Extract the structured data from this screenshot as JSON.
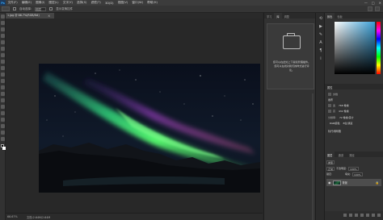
{
  "app": {
    "logo": "Ps",
    "menu": [
      "文件(F)",
      "编辑(E)",
      "图像(I)",
      "图层(L)",
      "文字(Y)",
      "选择(S)",
      "滤镜(T)",
      "3D(D)",
      "视图(V)",
      "窗口(W)",
      "帮助(H)"
    ],
    "window_controls": [
      "—",
      "□",
      "✕"
    ]
  },
  "options_bar": {
    "auto_select_label": "自动选择:",
    "auto_select_value": "图层",
    "show_transform_label": "显示变换控件"
  },
  "document": {
    "tab_label": "1.jpg @ 66.7%(RGB/8#)",
    "close": "×"
  },
  "status": {
    "zoom": "66.67%",
    "doc_info": "文档:2.64M/2.64M"
  },
  "learn_panel": {
    "tabs": [
      "学习",
      "库",
      "调整"
    ],
    "active_tab": "库",
    "message": "您可以在此处上下载和管理插件。您可以在线对我们的样式进行评论。"
  },
  "icon_strip": {
    "icons": [
      "history-icon",
      "play-icon",
      "brush-icon",
      "character-icon",
      "paragraph-icon",
      "info-icon"
    ]
  },
  "color_panel": {
    "tabs": [
      "颜色",
      "色板"
    ],
    "active_tab": "颜色"
  },
  "properties": {
    "tabs": [
      "属性"
    ],
    "doc_label": "文档",
    "canvas_section": "画布",
    "width_label": "宽",
    "width_value": "768 像素",
    "height_label": "高",
    "height_value": "432 像素",
    "res_label": "分辨率:",
    "res_value": "72 像素/英寸",
    "mode_value": "RGB颜色",
    "depth_value": "8位/通道",
    "guides_section": "标尺和网格"
  },
  "layers": {
    "tabs": [
      "图层",
      "通道",
      "路径"
    ],
    "active_tab": "图层",
    "filter_label": "类型",
    "blend_mode": "正常",
    "opacity_label": "不透明度:",
    "opacity_value": "100%",
    "lock_label": "锁定:",
    "fill_label": "填充:",
    "fill_value": "100%",
    "layer_name": "背景",
    "lock_icon": "🔒"
  },
  "colors": {
    "aurora_green": "#3ef07a",
    "aurora_purple": "#7a3aa0",
    "sky": "#0b1220",
    "panel_bg": "#323232"
  }
}
